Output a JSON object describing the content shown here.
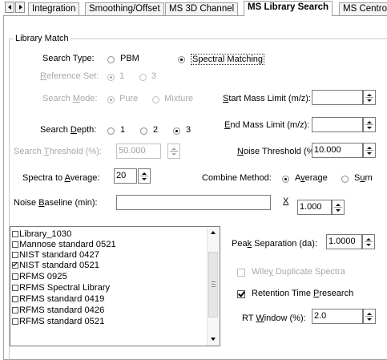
{
  "tabs": [
    {
      "label": "Integration",
      "active": false
    },
    {
      "label": "Smoothing/Offset",
      "active": false
    },
    {
      "label": "MS 3D Channel",
      "active": false
    },
    {
      "label": "MS Library Search",
      "active": true
    },
    {
      "label": "MS Centroid",
      "active": false
    }
  ],
  "group": {
    "title": "Library Match"
  },
  "search_type": {
    "label": "Search Type:",
    "options": [
      "PBM",
      "Spectral Matching"
    ],
    "selected": "Spectral Matching"
  },
  "reference_set": {
    "label": "Reference Set:",
    "options": [
      "1",
      "3"
    ],
    "selected": "1"
  },
  "search_mode": {
    "label": "Search Mode:",
    "options": [
      "Pure",
      "Mixture"
    ],
    "selected": "Pure"
  },
  "search_depth": {
    "label": "Search Depth:",
    "options": [
      "1",
      "2",
      "3"
    ],
    "selected": "3"
  },
  "search_threshold": {
    "label": "Search Threshold (%):",
    "value": "50.000"
  },
  "start_mass_limit": {
    "label": "Start Mass Limit (m/z):",
    "value": ""
  },
  "end_mass_limit": {
    "label": "End Mass Limit (m/z):",
    "value": ""
  },
  "noise_threshold": {
    "label": "Noise Threshold (%):",
    "value": "10.000"
  },
  "spectra_to_average": {
    "label": "Spectra to Average:",
    "value": "20"
  },
  "combine_method": {
    "label": "Combine Method:",
    "options": [
      "Average",
      "Sum"
    ],
    "selected": "Average"
  },
  "noise_baseline": {
    "label": "Noise Baseline (min):",
    "value": "",
    "multiplier_label": "X",
    "multiplier_value": "1.000"
  },
  "libraries": [
    {
      "name": "Library_1030",
      "checked": false
    },
    {
      "name": "Mannose standard 0521",
      "checked": false
    },
    {
      "name": "NIST standard 0427",
      "checked": false
    },
    {
      "name": "NIST standard 0521",
      "checked": true
    },
    {
      "name": "RFMS 0925",
      "checked": false
    },
    {
      "name": "RFMS Spectral Library",
      "checked": false
    },
    {
      "name": "RFMS standard 0419",
      "checked": false
    },
    {
      "name": "RFMS standard 0426",
      "checked": false
    },
    {
      "name": "RFMS standard 0521",
      "checked": false
    }
  ],
  "peak_separation": {
    "label": "Peak Separation (da):",
    "value": "1.0000"
  },
  "wiley_duplicate": {
    "label": "Wiley Duplicate Spectra",
    "checked": false,
    "enabled": false
  },
  "retention_time_presearch": {
    "label": "Retention Time Presearch",
    "checked": true
  },
  "rt_window": {
    "label": "RT Window (%):",
    "value": "2.0"
  }
}
